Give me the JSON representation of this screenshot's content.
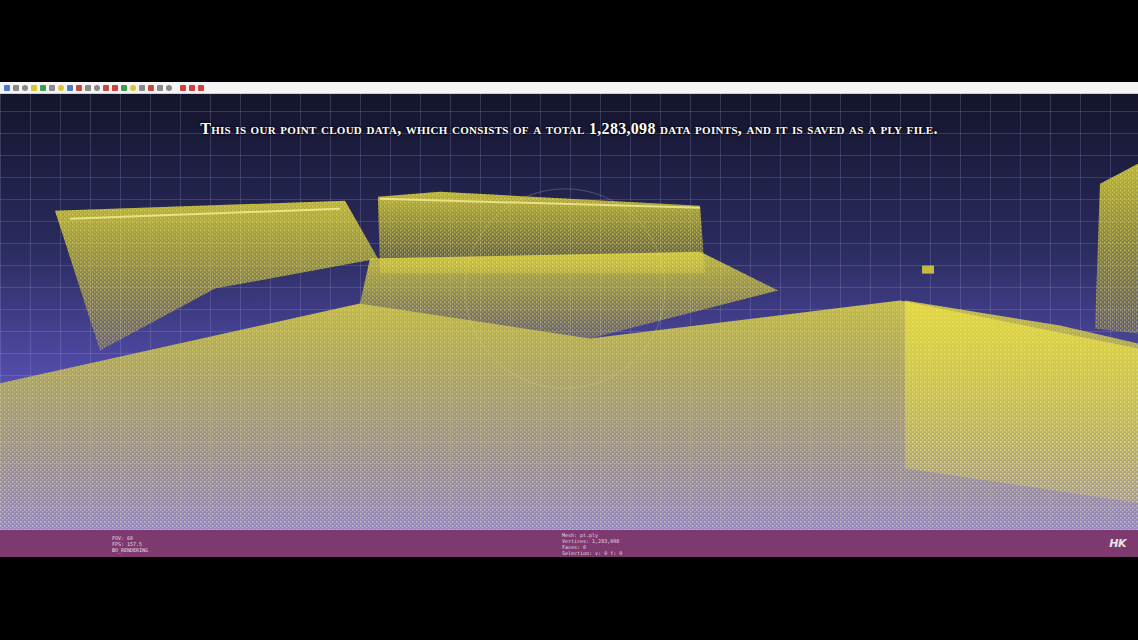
{
  "caption": "This is our point cloud data, which consists of a total 1,283,098 data points, and it is saved as a ply file.",
  "status_bar": {
    "left": [
      "FOV: 60",
      "FPS: 157.5",
      "BO_RENDERING"
    ],
    "center": [
      "Mesh: pt.ply",
      "Vertices: 1,283,098",
      "Faces: 0",
      "Selection: v: 0 f: 0"
    ]
  },
  "logo": "HK"
}
